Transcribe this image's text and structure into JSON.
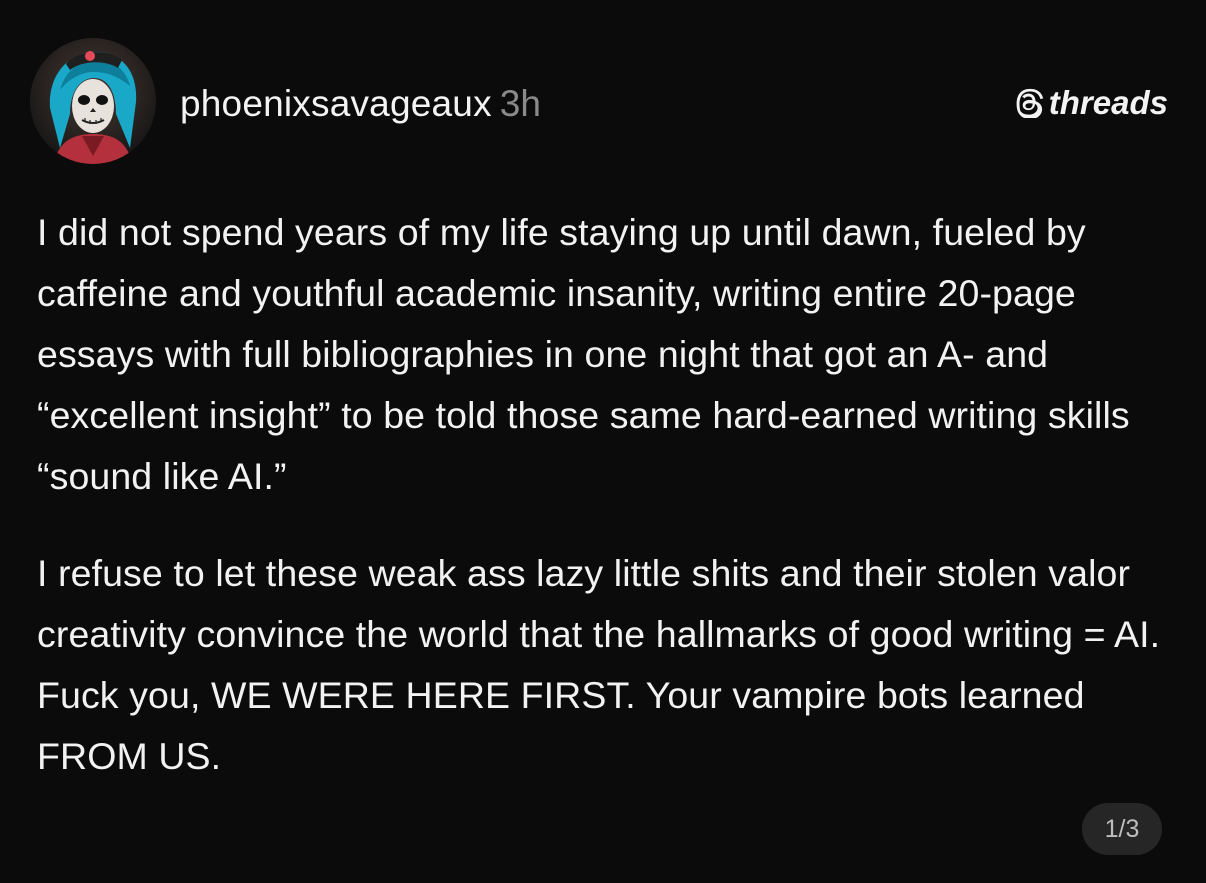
{
  "post": {
    "username": "phoenixsavageaux",
    "timestamp": "3h",
    "brand": "threads",
    "brand_icon": "threads-logo-icon",
    "avatar_icon": "profile-avatar",
    "paragraphs": [
      "I did not spend years of my life staying up until dawn, fueled by caffeine and youthful academic insanity, writing entire 20-page essays with full bibliographies in one night that got an A- and “excellent insight” to be told those same hard-earned writing skills “sound like AI.”",
      "I refuse to let these weak ass lazy little shits and their stolen valor creativity convince the world that the hallmarks of good writing = AI. Fuck you, WE WERE HERE FIRST. Your vampire bots learned FROM US."
    ],
    "page_indicator": "1/3"
  },
  "colors": {
    "background": "#0b0b0b",
    "text": "#f2f2f2",
    "muted": "#8a8a8a",
    "badge": "#262626"
  }
}
